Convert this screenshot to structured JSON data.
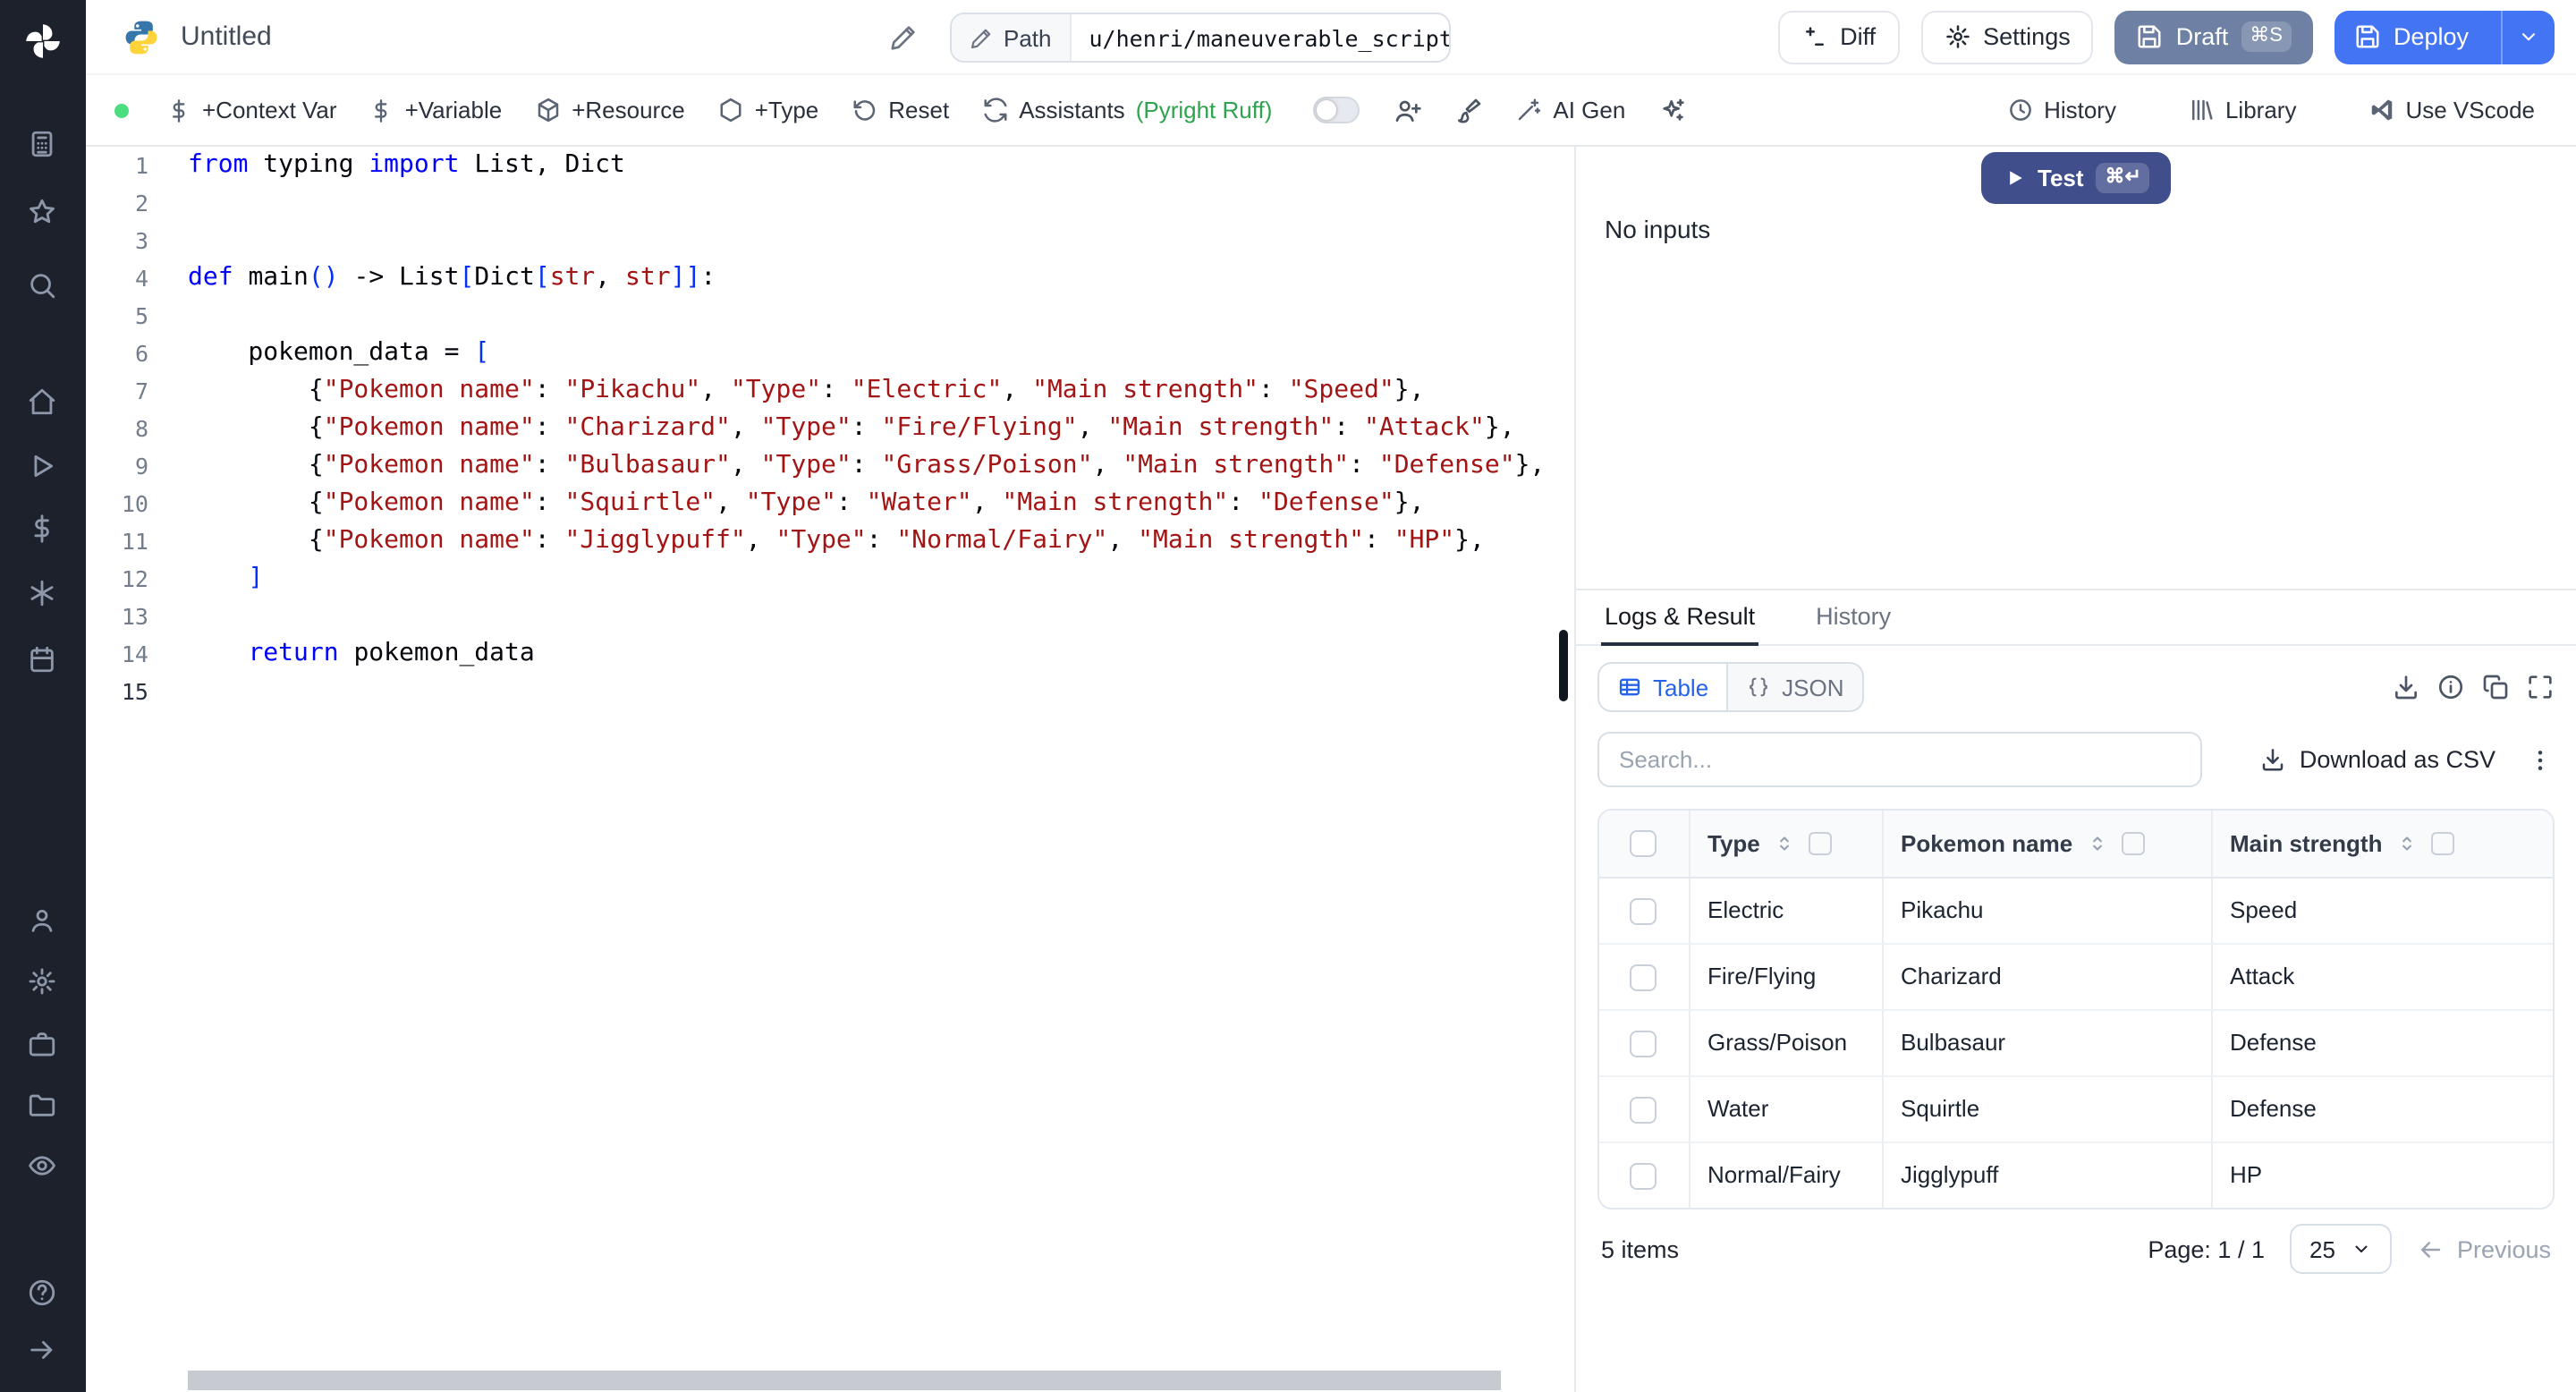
{
  "sidebar": {
    "items": [
      {
        "icon": "calculator",
        "name": "apps"
      },
      {
        "icon": "star",
        "name": "favorites"
      },
      {
        "icon": "search",
        "name": "search"
      },
      {
        "icon": "home",
        "name": "home"
      },
      {
        "icon": "play",
        "name": "runs"
      },
      {
        "icon": "dollar",
        "name": "variables"
      },
      {
        "icon": "asterisk",
        "name": "resources"
      },
      {
        "icon": "calendar",
        "name": "schedules"
      },
      {
        "icon": "user",
        "name": "users"
      },
      {
        "icon": "gear",
        "name": "settings"
      },
      {
        "icon": "briefcase",
        "name": "workers"
      },
      {
        "icon": "folder",
        "name": "folders"
      },
      {
        "icon": "eye",
        "name": "audit-logs"
      },
      {
        "icon": "help",
        "name": "help"
      },
      {
        "icon": "arrow-right",
        "name": "expand"
      }
    ]
  },
  "topbar": {
    "title": "Untitled",
    "path_label": "Path",
    "path_value": "u/henri/maneuverable_script",
    "diff_label": "Diff",
    "settings_label": "Settings",
    "draft_label": "Draft",
    "draft_shortcut": "⌘S",
    "deploy_label": "Deploy"
  },
  "toolbar": {
    "context_var_label": "+Context Var",
    "variable_label": "+Variable",
    "resource_label": "+Resource",
    "type_label": "+Type",
    "reset_label": "Reset",
    "assistants_label": "Assistants",
    "assistants_detail": "(Pyright Ruff)",
    "ai_gen_label": "AI Gen",
    "history_label": "History",
    "library_label": "Library",
    "vscode_label": "Use VScode"
  },
  "editor": {
    "lines": [
      {
        "n": "1",
        "tokens": [
          {
            "c": "k",
            "t": "from"
          },
          {
            "c": "p",
            "t": " typing "
          },
          {
            "c": "k",
            "t": "import"
          },
          {
            "c": "p",
            "t": " List, Dict"
          }
        ]
      },
      {
        "n": "2",
        "tokens": []
      },
      {
        "n": "3",
        "tokens": []
      },
      {
        "n": "4",
        "tokens": [
          {
            "c": "k",
            "t": "def"
          },
          {
            "c": "p",
            "t": " main"
          },
          {
            "c": "b",
            "t": "()"
          },
          {
            "c": "p",
            "t": " -> List"
          },
          {
            "c": "b",
            "t": "["
          },
          {
            "c": "p",
            "t": "Dict"
          },
          {
            "c": "b",
            "t": "["
          },
          {
            "c": "t",
            "t": "str"
          },
          {
            "c": "p",
            "t": ", "
          },
          {
            "c": "t",
            "t": "str"
          },
          {
            "c": "b",
            "t": "]]"
          },
          {
            "c": "p",
            "t": ":"
          }
        ]
      },
      {
        "n": "5",
        "tokens": []
      },
      {
        "n": "6",
        "tokens": [
          {
            "c": "p",
            "t": "    pokemon_data = "
          },
          {
            "c": "b",
            "t": "["
          }
        ]
      },
      {
        "n": "7",
        "tokens": [
          {
            "c": "p",
            "t": "        {"
          },
          {
            "c": "s",
            "t": "\"Pokemon name\""
          },
          {
            "c": "p",
            "t": ": "
          },
          {
            "c": "s",
            "t": "\"Pikachu\""
          },
          {
            "c": "p",
            "t": ", "
          },
          {
            "c": "s",
            "t": "\"Type\""
          },
          {
            "c": "p",
            "t": ": "
          },
          {
            "c": "s",
            "t": "\"Electric\""
          },
          {
            "c": "p",
            "t": ", "
          },
          {
            "c": "s",
            "t": "\"Main strength\""
          },
          {
            "c": "p",
            "t": ": "
          },
          {
            "c": "s",
            "t": "\"Speed\""
          },
          {
            "c": "p",
            "t": "},"
          }
        ]
      },
      {
        "n": "8",
        "tokens": [
          {
            "c": "p",
            "t": "        {"
          },
          {
            "c": "s",
            "t": "\"Pokemon name\""
          },
          {
            "c": "p",
            "t": ": "
          },
          {
            "c": "s",
            "t": "\"Charizard\""
          },
          {
            "c": "p",
            "t": ", "
          },
          {
            "c": "s",
            "t": "\"Type\""
          },
          {
            "c": "p",
            "t": ": "
          },
          {
            "c": "s",
            "t": "\"Fire/Flying\""
          },
          {
            "c": "p",
            "t": ", "
          },
          {
            "c": "s",
            "t": "\"Main strength\""
          },
          {
            "c": "p",
            "t": ": "
          },
          {
            "c": "s",
            "t": "\"Attack\""
          },
          {
            "c": "p",
            "t": "},"
          }
        ]
      },
      {
        "n": "9",
        "tokens": [
          {
            "c": "p",
            "t": "        {"
          },
          {
            "c": "s",
            "t": "\"Pokemon name\""
          },
          {
            "c": "p",
            "t": ": "
          },
          {
            "c": "s",
            "t": "\"Bulbasaur\""
          },
          {
            "c": "p",
            "t": ", "
          },
          {
            "c": "s",
            "t": "\"Type\""
          },
          {
            "c": "p",
            "t": ": "
          },
          {
            "c": "s",
            "t": "\"Grass/Poison\""
          },
          {
            "c": "p",
            "t": ", "
          },
          {
            "c": "s",
            "t": "\"Main strength\""
          },
          {
            "c": "p",
            "t": ": "
          },
          {
            "c": "s",
            "t": "\"Defense\""
          },
          {
            "c": "p",
            "t": "},"
          }
        ]
      },
      {
        "n": "10",
        "tokens": [
          {
            "c": "p",
            "t": "        {"
          },
          {
            "c": "s",
            "t": "\"Pokemon name\""
          },
          {
            "c": "p",
            "t": ": "
          },
          {
            "c": "s",
            "t": "\"Squirtle\""
          },
          {
            "c": "p",
            "t": ", "
          },
          {
            "c": "s",
            "t": "\"Type\""
          },
          {
            "c": "p",
            "t": ": "
          },
          {
            "c": "s",
            "t": "\"Water\""
          },
          {
            "c": "p",
            "t": ", "
          },
          {
            "c": "s",
            "t": "\"Main strength\""
          },
          {
            "c": "p",
            "t": ": "
          },
          {
            "c": "s",
            "t": "\"Defense\""
          },
          {
            "c": "p",
            "t": "},"
          }
        ]
      },
      {
        "n": "11",
        "tokens": [
          {
            "c": "p",
            "t": "        {"
          },
          {
            "c": "s",
            "t": "\"Pokemon name\""
          },
          {
            "c": "p",
            "t": ": "
          },
          {
            "c": "s",
            "t": "\"Jigglypuff\""
          },
          {
            "c": "p",
            "t": ", "
          },
          {
            "c": "s",
            "t": "\"Type\""
          },
          {
            "c": "p",
            "t": ": "
          },
          {
            "c": "s",
            "t": "\"Normal/Fairy\""
          },
          {
            "c": "p",
            "t": ", "
          },
          {
            "c": "s",
            "t": "\"Main strength\""
          },
          {
            "c": "p",
            "t": ": "
          },
          {
            "c": "s",
            "t": "\"HP\""
          },
          {
            "c": "p",
            "t": "},"
          }
        ]
      },
      {
        "n": "12",
        "tokens": [
          {
            "c": "p",
            "t": "    "
          },
          {
            "c": "b",
            "t": "]"
          }
        ]
      },
      {
        "n": "13",
        "tokens": []
      },
      {
        "n": "14",
        "tokens": [
          {
            "c": "p",
            "t": "    "
          },
          {
            "c": "k",
            "t": "return"
          },
          {
            "c": "p",
            "t": " pokemon_data"
          }
        ]
      },
      {
        "n": "15",
        "tokens": [],
        "active": true
      }
    ]
  },
  "runner": {
    "test_label": "Test",
    "test_shortcut": "⌘↵",
    "no_inputs": "No inputs"
  },
  "results": {
    "tab_logs": "Logs & Result",
    "tab_history": "History",
    "view_table": "Table",
    "view_json": "JSON",
    "search_placeholder": "Search...",
    "download_csv": "Download as CSV",
    "table": {
      "columns": [
        "Type",
        "Pokemon name",
        "Main strength"
      ],
      "rows": [
        [
          "Electric",
          "Pikachu",
          "Speed"
        ],
        [
          "Fire/Flying",
          "Charizard",
          "Attack"
        ],
        [
          "Grass/Poison",
          "Bulbasaur",
          "Defense"
        ],
        [
          "Water",
          "Squirtle",
          "Defense"
        ],
        [
          "Normal/Fairy",
          "Jigglypuff",
          "HP"
        ]
      ]
    },
    "footer": {
      "items_count": "5 items",
      "page_label": "Page: 1 / 1",
      "page_size": "25",
      "previous_label": "Previous"
    }
  },
  "colors": {
    "deploy_blue": "#4374f4",
    "draft_slate": "#6e80a3",
    "test_navy": "#404e8c",
    "accent_violet": "#8b5cf6",
    "assistant_green": "#2da44e",
    "status_green": "#4ade80"
  }
}
